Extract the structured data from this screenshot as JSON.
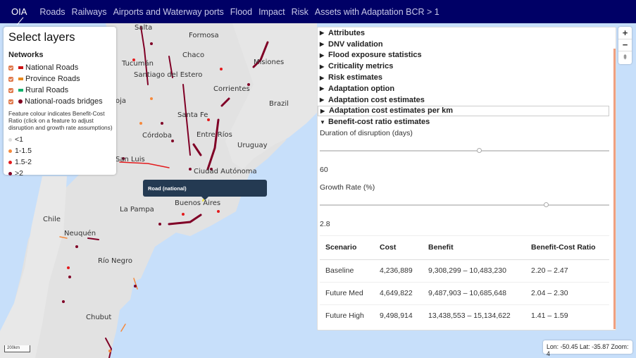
{
  "navbar": {
    "brand": "OIA",
    "links": [
      "Roads",
      "Railways",
      "Airports and Waterway ports",
      "Flood",
      "Impact",
      "Risk",
      "Assets with Adaptation BCR > 1"
    ]
  },
  "layers": {
    "title": "Select layers",
    "section": "Networks",
    "items": [
      {
        "label": "National Roads",
        "color": "#cc1111",
        "shape": "line",
        "checked": true
      },
      {
        "label": "Province Roads",
        "color": "#e8891c",
        "shape": "line",
        "checked": true
      },
      {
        "label": "Rural Roads",
        "color": "#11b36b",
        "shape": "line",
        "checked": true
      },
      {
        "label": "National-roads bridges",
        "color": "#800020",
        "shape": "dot",
        "checked": true
      }
    ],
    "note": "Feature colour indicates Benefit-Cost Ratio (click on a feature to adjust disruption and growth rate assumptions)",
    "legend": [
      {
        "label": "<1",
        "color": "#dddddd"
      },
      {
        "label": "1-1.5",
        "color": "#f5893c"
      },
      {
        "label": "1.5-2",
        "color": "#e31a1c"
      },
      {
        "label": ">2",
        "color": "#800026"
      }
    ]
  },
  "map": {
    "labels": [
      {
        "text": "Salta"
      },
      {
        "text": "Formosa"
      },
      {
        "text": "Chaco"
      },
      {
        "text": "Misiones"
      },
      {
        "text": "Tucumán"
      },
      {
        "text": "Santiago del Estero"
      },
      {
        "text": "Corrientes"
      },
      {
        "text": "Brazil"
      },
      {
        "text": "oja"
      },
      {
        "text": "Santa Fe"
      },
      {
        "text": "Córdoba"
      },
      {
        "text": "Entre Ríos"
      },
      {
        "text": "Uruguay"
      },
      {
        "text": "San Luis"
      },
      {
        "text": "Ciudad Autónoma"
      },
      {
        "text": "Buenos Aires"
      },
      {
        "text": "La Pampa"
      },
      {
        "text": "Chile"
      },
      {
        "text": "Neuquén"
      },
      {
        "text": "Río Negro"
      },
      {
        "text": "Chubut"
      }
    ],
    "tooltip": "Road (national)",
    "scale": "200km",
    "coords": "Lon: -50.45 Lat: -35.87 Zoom: 4",
    "zoom_in": "+",
    "zoom_out": "−",
    "reset_north": "⇞"
  },
  "panel": {
    "sections": [
      {
        "label": "Attributes",
        "open": false
      },
      {
        "label": "DNV validation",
        "open": false
      },
      {
        "label": "Flood exposure statistics",
        "open": false
      },
      {
        "label": "Criticality metrics",
        "open": false
      },
      {
        "label": "Risk estimates",
        "open": false
      },
      {
        "label": "Adaptation option",
        "open": false
      },
      {
        "label": "Adaptation cost estimates",
        "open": false
      },
      {
        "label": "Adaptation cost estimates per km",
        "open": false,
        "focused": true
      },
      {
        "label": "Benefit-cost ratio estimates",
        "open": true
      }
    ],
    "duration": {
      "label": "Duration of disruption (days)",
      "value": "60",
      "fraction": 0.55
    },
    "growth": {
      "label": "Growth Rate (%)",
      "value": "2.8",
      "fraction": 0.78
    },
    "table": {
      "headers": [
        "Scenario",
        "Cost",
        "Benefit",
        "Benefit-Cost Ratio"
      ],
      "rows": [
        [
          "Baseline",
          "4,236,889",
          "9,308,299 – 10,483,230",
          "2.20 – 2.47"
        ],
        [
          "Future Med",
          "4,649,822",
          "9,487,903 – 10,685,648",
          "2.04 – 2.30"
        ],
        [
          "Future High",
          "9,498,914",
          "13,438,553 – 15,134,622",
          "1.41 – 1.59"
        ]
      ]
    }
  }
}
